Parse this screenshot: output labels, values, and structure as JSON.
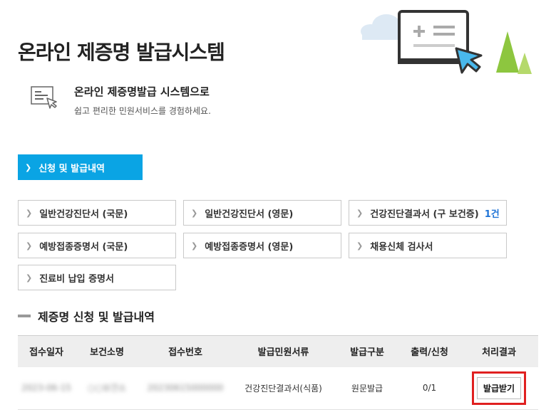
{
  "page": {
    "title": "온라인 제증명 발급시스템"
  },
  "intro": {
    "title": "온라인 제증명발급 시스템으로",
    "subtitle": "쉽고 편리한 민원서비스를 경험하세요."
  },
  "tabs": [
    {
      "label": "신청 및 발급내역",
      "active": true
    }
  ],
  "documents": [
    {
      "label": "일반건강진단서 (국문)"
    },
    {
      "label": "일반건강진단서 (영문)"
    },
    {
      "label": "건강진단결과서 (구 보건증)",
      "count": "1건"
    },
    {
      "label": "예방접종증명서 (국문)"
    },
    {
      "label": "예방접종증명서 (영문)"
    },
    {
      "label": "채용신체 검사서"
    },
    {
      "label": "진료비 납입 증명서"
    }
  ],
  "section": {
    "title": "제증명 신청 및 발급내역"
  },
  "table": {
    "headers": [
      "접수일자",
      "보건소명",
      "접수번호",
      "발급민원서류",
      "발급구분",
      "출력/신청",
      "처리결과"
    ],
    "rows": [
      {
        "date": "2023-06-15",
        "center": "○○보건소",
        "receipt_no": "20230615000000",
        "document": "건강진단결과서(식품)",
        "issue_type": "원문발급",
        "print_ratio": "0/1",
        "action": "발급받기"
      }
    ]
  },
  "colors": {
    "accent": "#0aa4e4",
    "link": "#1e73d6",
    "highlight": "#e02020"
  },
  "icons": {
    "intro": "document-cursor-icon",
    "hero": "certificate-monitor-illustration",
    "chevron": "chevron-right-icon"
  }
}
